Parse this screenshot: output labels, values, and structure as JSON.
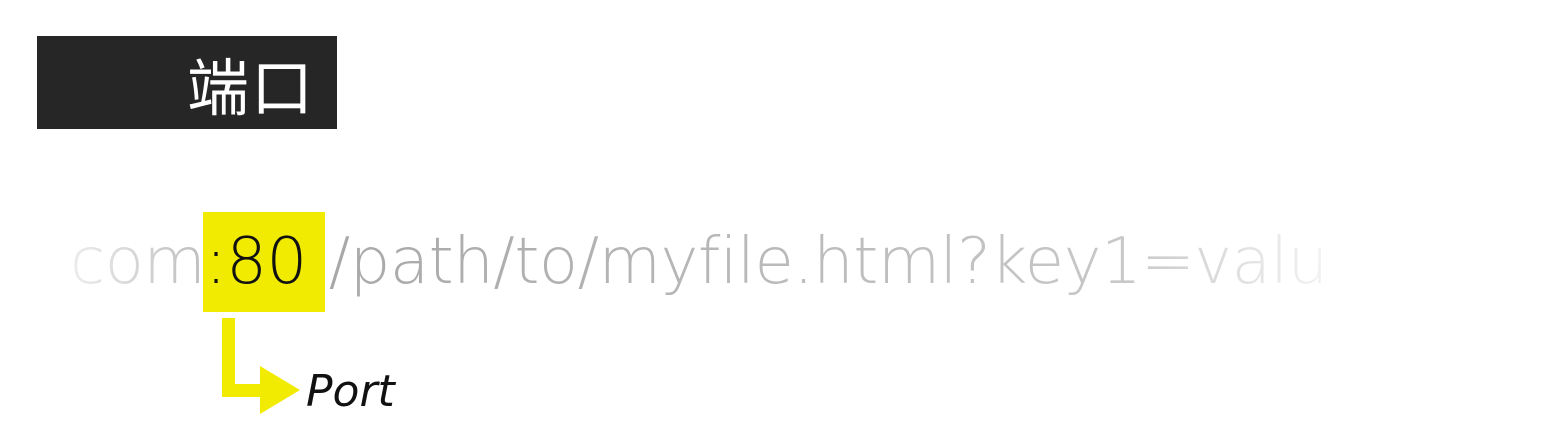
{
  "title": "端口",
  "url": {
    "before": "com",
    "port": ":80",
    "after": "/path/to/myfile.html?key1=valu"
  },
  "callout": {
    "label": "Port"
  },
  "colors": {
    "highlight": "#f0eb00",
    "title_bg": "#262626",
    "title_text": "#ffffff",
    "url_text": "#b5b5b5",
    "label_text": "#111111"
  }
}
